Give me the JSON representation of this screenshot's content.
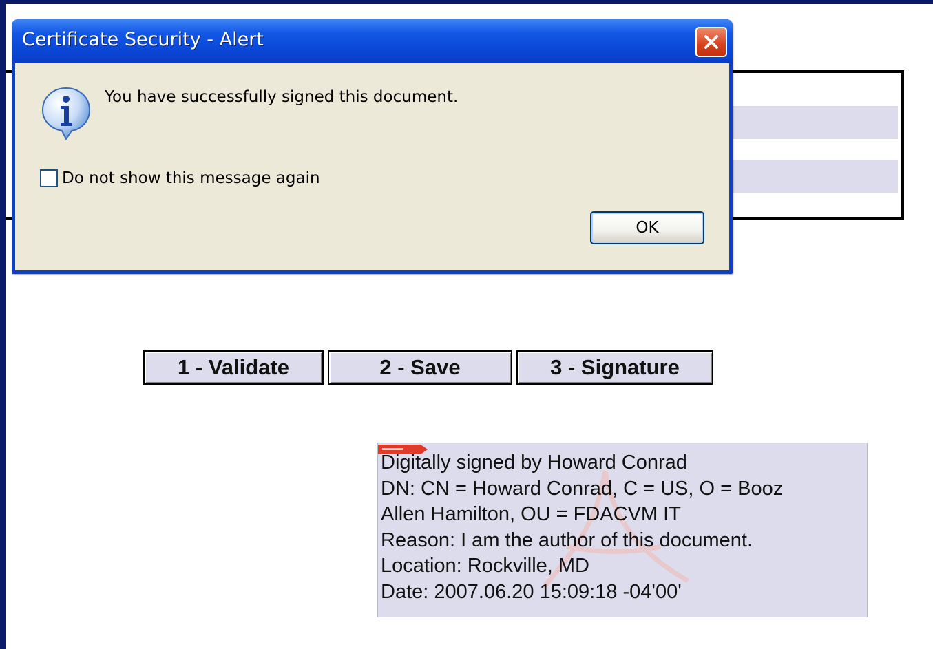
{
  "dialog": {
    "title": "Certificate Security - Alert",
    "message": "You have successfully signed this document.",
    "checkbox_label": "Do not show this message again",
    "checkbox_checked": false,
    "ok_label": "OK",
    "icon": "info-icon",
    "close_icon": "close-icon"
  },
  "buttons": [
    {
      "label": "1 - Validate"
    },
    {
      "label": "2 - Save"
    },
    {
      "label": "3 - Signature"
    }
  ],
  "signature": {
    "lines": [
      "Digitally signed by Howard Conrad",
      "DN: CN = Howard Conrad, C = US, O = Booz",
      "Allen Hamilton, OU = FDACVM IT",
      "Reason: I am the author of this document.",
      "Location: Rockville, MD",
      "Date: 2007.06.20 15:09:18 -04'00'"
    ]
  },
  "colors": {
    "frame": "#0c1a6a",
    "title_bar": "#0a47d6",
    "dialog_client": "#ece9d8",
    "button_face": "#dcdcec",
    "close_button": "#d8401e"
  }
}
